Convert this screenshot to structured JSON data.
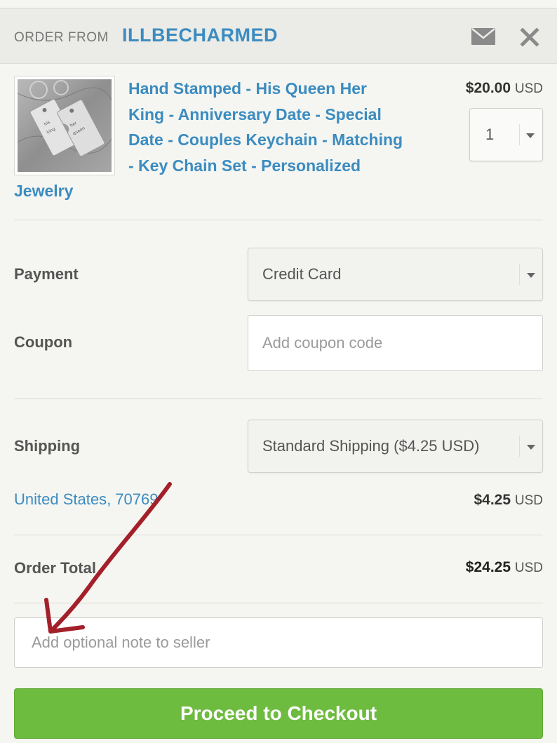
{
  "header": {
    "order_from_label": "ORDER FROM",
    "shop_name": "ILLBECHARMED",
    "mail_icon": "mail-icon",
    "close_icon": "close-icon"
  },
  "item": {
    "thumbnail": "keychain-photo",
    "title_lines": [
      "Hand Stamped - His Queen Her",
      "King - Anniversary Date - Special",
      "Date - Couples Keychain - Matching",
      "- Key Chain Set - Personalized",
      "Jewelry"
    ],
    "price_amount": "$20.00",
    "price_currency": "USD",
    "quantity": "1"
  },
  "payment": {
    "label": "Payment",
    "selected": "Credit Card"
  },
  "coupon": {
    "label": "Coupon",
    "placeholder": "Add coupon code",
    "value": ""
  },
  "shipping": {
    "label": "Shipping",
    "selected": "Standard Shipping ($4.25 USD)",
    "location": "United States, 70769",
    "cost_amount": "$4.25",
    "cost_currency": "USD"
  },
  "order_total": {
    "label": "Order Total",
    "amount": "$24.25",
    "currency": "USD"
  },
  "note": {
    "placeholder": "Add optional note to seller",
    "value": ""
  },
  "checkout": {
    "label": "Proceed to Checkout"
  },
  "colors": {
    "link_blue": "#3b8cc0",
    "checkout_green": "#6dbb3f",
    "annotation_arrow": "#a3202a"
  }
}
